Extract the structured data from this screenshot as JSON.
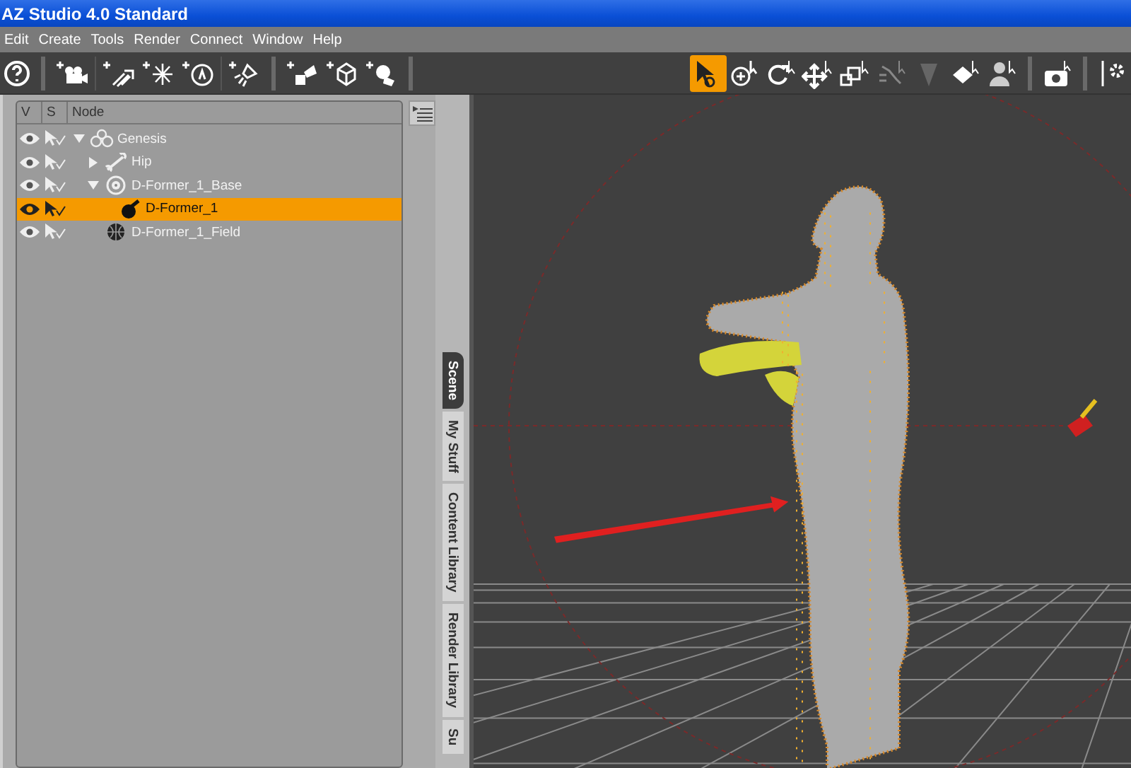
{
  "window": {
    "title": "AZ Studio 4.0 Standard"
  },
  "menu": [
    "Edit",
    "Create",
    "Tools",
    "Render",
    "Connect",
    "Window",
    "Help"
  ],
  "toolbar_left": [
    {
      "kind": "help"
    },
    {
      "kind": "camera"
    },
    {
      "kind": "distant-light"
    },
    {
      "kind": "point-light"
    },
    {
      "kind": "spot-dial"
    },
    {
      "kind": "spot-light"
    },
    {
      "kind": "primitive"
    },
    {
      "kind": "null"
    },
    {
      "kind": "deformer"
    }
  ],
  "toolbar_right": [
    {
      "kind": "pointer",
      "selected": true
    },
    {
      "kind": "universal",
      "selected": false
    },
    {
      "kind": "rotate",
      "selected": false
    },
    {
      "kind": "move",
      "selected": false
    },
    {
      "kind": "scale",
      "selected": false
    },
    {
      "kind": "joint",
      "selected": false
    },
    {
      "kind": "triangle",
      "selected": false
    },
    {
      "kind": "region",
      "selected": false
    },
    {
      "kind": "figure",
      "selected": false
    },
    {
      "kind": "render",
      "selected": false
    },
    {
      "kind": "settings",
      "selected": false
    }
  ],
  "scene": {
    "columns": [
      "V",
      "S",
      "Node"
    ],
    "tree": [
      {
        "label": "Genesis",
        "kind": "figure",
        "visible": true,
        "selected": false,
        "expanded": true,
        "children": [
          {
            "label": "Hip",
            "kind": "bone",
            "visible": true,
            "selected": false,
            "expanded": false
          },
          {
            "label": "D-Former_1_Base",
            "kind": "base",
            "visible": true,
            "selected": false,
            "expanded": true,
            "children": [
              {
                "label": "D-Former_1",
                "kind": "deformer",
                "visible": true,
                "selected": true
              }
            ]
          },
          {
            "label": "D-Former_1_Field",
            "kind": "field",
            "visible": true,
            "selected": false
          }
        ]
      }
    ]
  },
  "side_tabs": [
    {
      "label": "Scene",
      "selected": true
    },
    {
      "label": "My Stuff",
      "selected": false
    },
    {
      "label": "Content Library",
      "selected": false
    },
    {
      "label": "Render Library",
      "selected": false
    },
    {
      "label": "Su",
      "selected": false
    }
  ]
}
